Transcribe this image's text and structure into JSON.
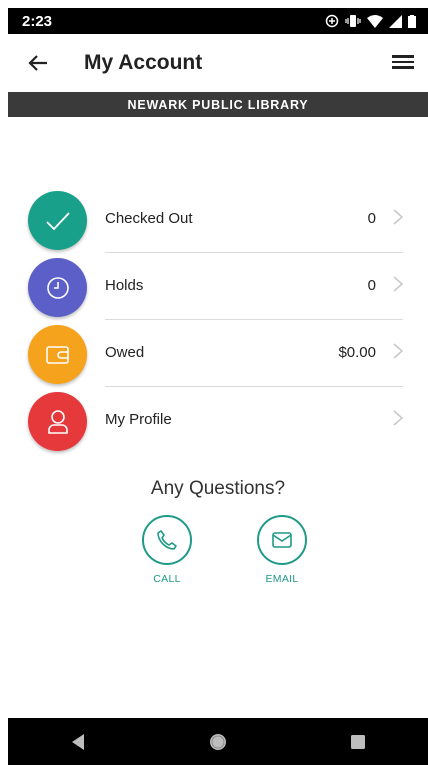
{
  "status_bar": {
    "time": "2:23"
  },
  "app_bar": {
    "title": "My Account"
  },
  "library_banner": "NEWARK PUBLIC LIBRARY",
  "account_items": [
    {
      "label": "Checked Out",
      "value": "0",
      "icon": "check-icon",
      "color": "#19A08A"
    },
    {
      "label": "Holds",
      "value": "0",
      "icon": "clock-icon",
      "color": "#5B5FC7"
    },
    {
      "label": "Owed",
      "value": "$0.00",
      "icon": "wallet-icon",
      "color": "#F5A21C"
    },
    {
      "label": "My Profile",
      "value": "",
      "icon": "person-icon",
      "color": "#E5393C"
    }
  ],
  "questions": {
    "heading": "Any Questions?",
    "call_label": "CALL",
    "email_label": "EMAIL",
    "accent": "#1F9A87"
  }
}
